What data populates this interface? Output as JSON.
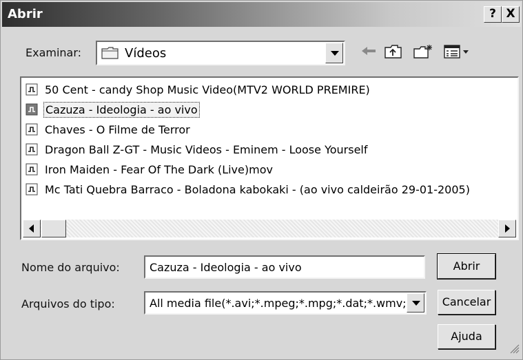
{
  "window": {
    "title": "Abrir"
  },
  "titlebar": {
    "help_label": "?",
    "close_label": "X"
  },
  "look_in": {
    "label": "Examinar:",
    "value": "Vídeos",
    "icon": "folder-icon"
  },
  "toolbar": {
    "icons": [
      "back-arrow-icon",
      "up-folder-icon",
      "new-folder-icon",
      "view-menu-icon"
    ]
  },
  "files": [
    {
      "name": "50 Cent - candy Shop Music Video(MTV2 WORLD PREMIRE)",
      "selected": false
    },
    {
      "name": "Cazuza - Ideologia - ao vivo",
      "selected": true
    },
    {
      "name": "Chaves - O Filme de Terror",
      "selected": false
    },
    {
      "name": "Dragon Ball Z-GT - Music Videos - Eminem - Loose Yourself",
      "selected": false
    },
    {
      "name": "Iron Maiden - Fear Of The Dark (Live)mov",
      "selected": false
    },
    {
      "name": "Mc Tati Quebra Barraco - Boladona kabokaki - (ao vivo caldeirão 29-01-2005)",
      "selected": false
    }
  ],
  "filename": {
    "label": "Nome do arquivo:",
    "value": "Cazuza - Ideologia - ao vivo"
  },
  "filetype": {
    "label": "Arquivos do tipo:",
    "value": "All media file(*.avi;*.mpeg;*.mpg;*.dat;*.wmv;*"
  },
  "buttons": {
    "open": "Abrir",
    "cancel": "Cancelar",
    "help": "Ajuda"
  }
}
